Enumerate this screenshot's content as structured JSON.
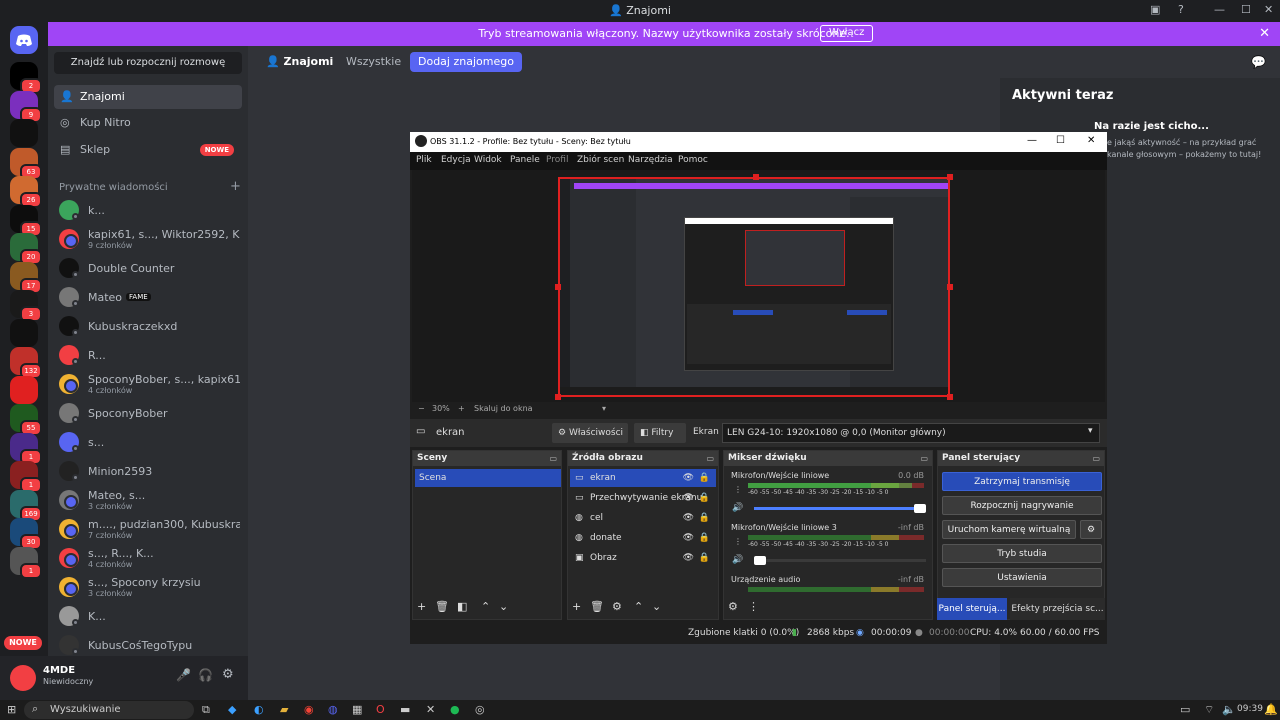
{
  "window": {
    "title": "Znajomi"
  },
  "banner": {
    "message": "Tryb streamowania włączony. Nazwy użytkownika zostały skrócone.",
    "button": "Wyłącz"
  },
  "sidebar": {
    "search_placeholder": "Znajdź lub rozpocznij rozmowę",
    "nav": [
      {
        "label": "Znajomi"
      },
      {
        "label": "Kup Nitro"
      },
      {
        "label": "Sklep",
        "badge": "NOWE"
      }
    ],
    "dm_header": "Prywatne wiadomości",
    "dms": [
      {
        "name": "k...",
        "sub": ""
      },
      {
        "name": "kapix61, s..., Wiktor2592, K..., ...",
        "sub": "9 członków"
      },
      {
        "name": "Double Counter",
        "sub": ""
      },
      {
        "name": "Mateo",
        "sub": "",
        "tag": "FAME"
      },
      {
        "name": "Kubuskraczekxd",
        "sub": ""
      },
      {
        "name": "R...",
        "sub": ""
      },
      {
        "name": "SpoconyBober, s..., kapix61",
        "sub": "4 członków"
      },
      {
        "name": "SpoconyBober",
        "sub": ""
      },
      {
        "name": "s...",
        "sub": ""
      },
      {
        "name": "Minion2593",
        "sub": ""
      },
      {
        "name": "Mateo, s...",
        "sub": "3 członków"
      },
      {
        "name": "m...., pudzian300, Kubuskracz...",
        "sub": "7 członków"
      },
      {
        "name": "s..., R..., K...",
        "sub": "4 członków"
      },
      {
        "name": "s..., Spocony krzysiu",
        "sub": "3 członków"
      },
      {
        "name": "K...",
        "sub": ""
      },
      {
        "name": "KubusCośTegoTypu",
        "sub": ""
      }
    ]
  },
  "rail": {
    "badges": [
      "2",
      "9",
      "",
      "63",
      "26",
      "15",
      "20",
      "17",
      "3",
      "",
      "132",
      "",
      "55",
      "1",
      "1",
      "169",
      "30",
      "1"
    ],
    "nowe": "NOWE"
  },
  "user": {
    "name": "4MDE",
    "status": "Niewidoczny"
  },
  "topbar": {
    "title": "Znajomi",
    "tab_all": "Wszystkie",
    "add_friend": "Dodaj znajomego"
  },
  "active_now": {
    "title": "Aktywni teraz",
    "empty_title": "Na razie jest cicho...",
    "empty_line1": "e jakąś aktywność – na przykład grać",
    "empty_line2": "kanale głosowym – pokażemy to tutaj!"
  },
  "obs": {
    "title": "OBS 31.1.2 - Profile: Bez tytułu - Sceny: Bez tytułu",
    "menu": [
      "Plik",
      "Edycja",
      "Widok",
      "Panele",
      "Profil",
      "Zbiór scen",
      "Narzędzia",
      "Pomoc"
    ],
    "zoom": "30%",
    "zoom_mode": "Skaluj do okna",
    "source_name": "ekran",
    "properties": "Właściwości",
    "filters": "Filtry",
    "screen_label": "Ekran",
    "screen_value": "LEN G24-10: 1920x1080 @ 0,0 (Monitor główny)",
    "scenes": {
      "title": "Sceny",
      "items": [
        "Scena"
      ]
    },
    "sources": {
      "title": "Źródła obrazu",
      "items": [
        {
          "name": "ekran",
          "icon": "monitor"
        },
        {
          "name": "Przechwytywanie ekranu",
          "icon": "monitor"
        },
        {
          "name": "cel",
          "icon": "globe"
        },
        {
          "name": "donate",
          "icon": "globe"
        },
        {
          "name": "Obraz",
          "icon": "image"
        }
      ]
    },
    "mixer": {
      "title": "Mikser dźwięku",
      "scale": "-60 -55 -50 -45 -40 -35 -30 -25 -20 -15 -10 -5 0",
      "channels": [
        {
          "name": "Mikrofon/Wejście liniowe",
          "db": "0.0 dB",
          "level": 0.93,
          "volume": 1.0
        },
        {
          "name": "Mikrofon/Wejście liniowe 3",
          "db": "-inf dB",
          "level": 0.0,
          "volume": 0.05
        },
        {
          "name": "Urządzenie audio",
          "db": "-inf dB",
          "level": 0.0,
          "volume": 0.0
        }
      ]
    },
    "controls": {
      "title": "Panel sterujący",
      "stream": "Zatrzymaj transmisję",
      "record": "Rozpocznij nagrywanie",
      "vcam": "Uruchom kamerę wirtualną",
      "studio": "Tryb studia",
      "settings": "Ustawienia"
    },
    "bottom_tabs": {
      "controls": "Panel sterują...",
      "transitions": "Efekty przejścia sc..."
    },
    "status": {
      "dropped": "Zgubione klatki 0 (0.0%)",
      "bitrate": "2868 kbps",
      "stream_time": "00:00:09",
      "rec_time": "00:00:00",
      "cpu": "CPU: 4.0%",
      "fps": "60.00 / 60.00 FPS"
    }
  },
  "taskbar": {
    "search": "Wyszukiwanie",
    "time": "09:39"
  },
  "colors": {
    "banner": "#a045f6",
    "blurple": "#5865f2",
    "selection": "#284cb8",
    "danger": "#f23f43"
  }
}
